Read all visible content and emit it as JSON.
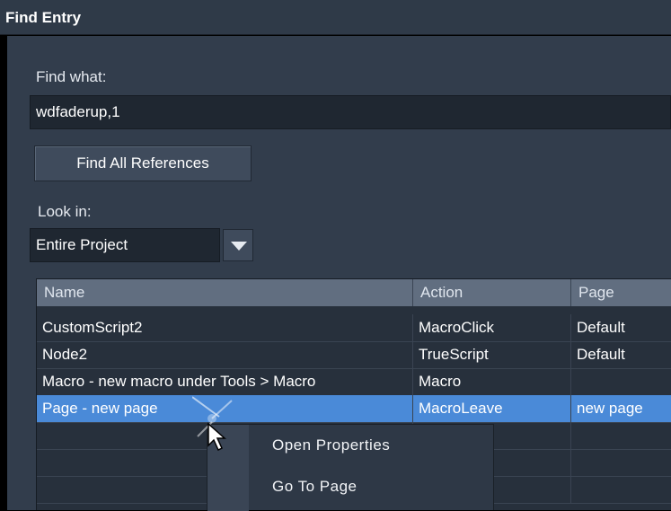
{
  "window": {
    "title": "Find Entry"
  },
  "find": {
    "label": "Find what:",
    "value": "wdfaderup,1",
    "button": "Find All References"
  },
  "look_in": {
    "label": "Look in:",
    "selected": "Entire Project"
  },
  "results": {
    "columns": [
      "Name",
      "Action",
      "Page"
    ],
    "rows": [
      {
        "name": "CustomScript2",
        "action": "MacroClick",
        "page": "Default"
      },
      {
        "name": "Node2",
        "action": "TrueScript",
        "page": "Default"
      },
      {
        "name": "Macro - new macro under Tools > Macro",
        "action": "Macro",
        "page": ""
      },
      {
        "name": "Page - new page",
        "action": "MacroLeave",
        "page": "new page",
        "selected": true
      }
    ]
  },
  "context_menu": {
    "items": [
      "Open Properties",
      "Go To Page"
    ]
  },
  "colors": {
    "selection": "#4a8ad8",
    "panel": "#323d4c",
    "header": "#616e80"
  },
  "icons": {
    "dropdown": "chevron-down-icon",
    "cursor": "mouse-pointer-icon"
  }
}
